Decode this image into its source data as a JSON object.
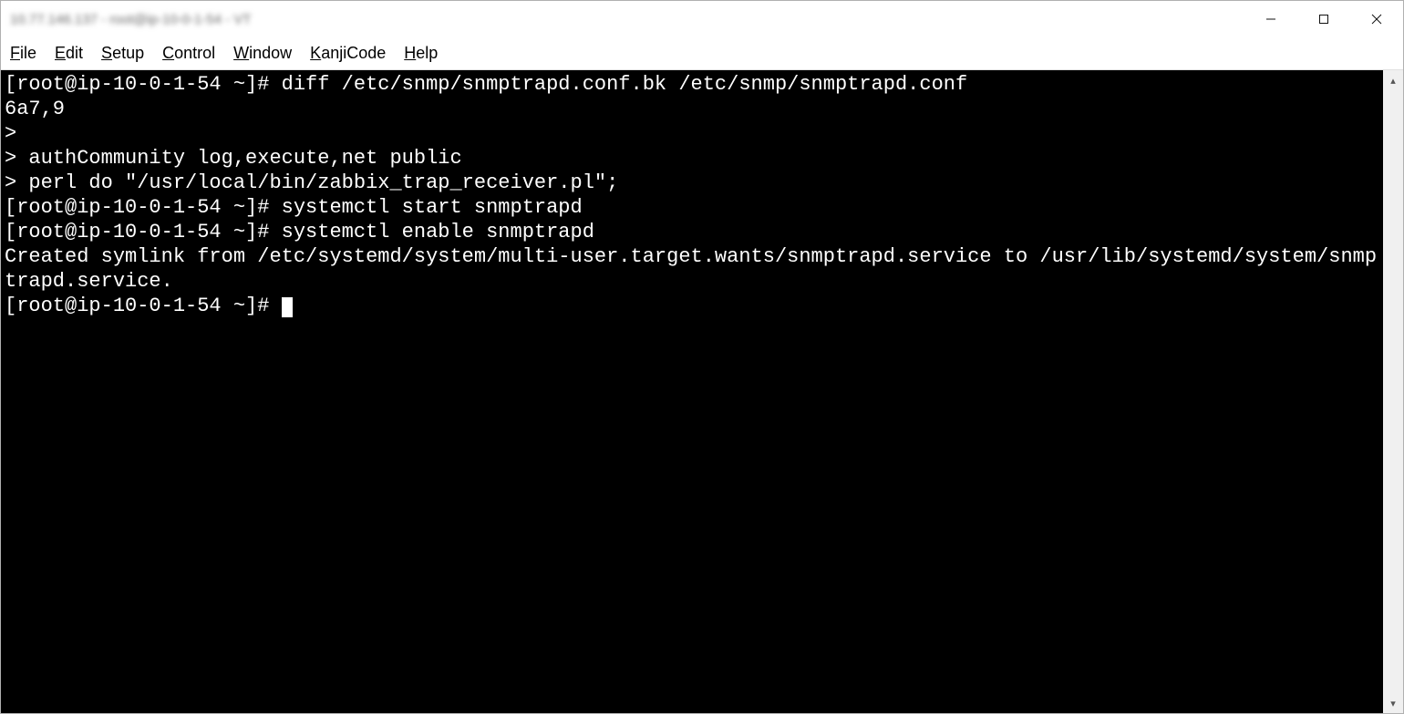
{
  "window": {
    "title": "10.77.146.137 - root@ip-10-0-1-54 - VT"
  },
  "menu": {
    "file": "File",
    "edit": "Edit",
    "setup": "Setup",
    "control": "Control",
    "window": "Window",
    "kanji": "KanjiCode",
    "help": "Help"
  },
  "terminal": {
    "lines": [
      "[root@ip-10-0-1-54 ~]# diff /etc/snmp/snmptrapd.conf.bk /etc/snmp/snmptrapd.conf",
      "6a7,9",
      ">",
      "> authCommunity log,execute,net public",
      "> perl do \"/usr/local/bin/zabbix_trap_receiver.pl\";",
      "[root@ip-10-0-1-54 ~]# systemctl start snmptrapd",
      "[root@ip-10-0-1-54 ~]# systemctl enable snmptrapd",
      "Created symlink from /etc/systemd/system/multi-user.target.wants/snmptrapd.service to /usr/lib/systemd/system/snmptrapd.service."
    ],
    "prompt": "[root@ip-10-0-1-54 ~]# "
  }
}
